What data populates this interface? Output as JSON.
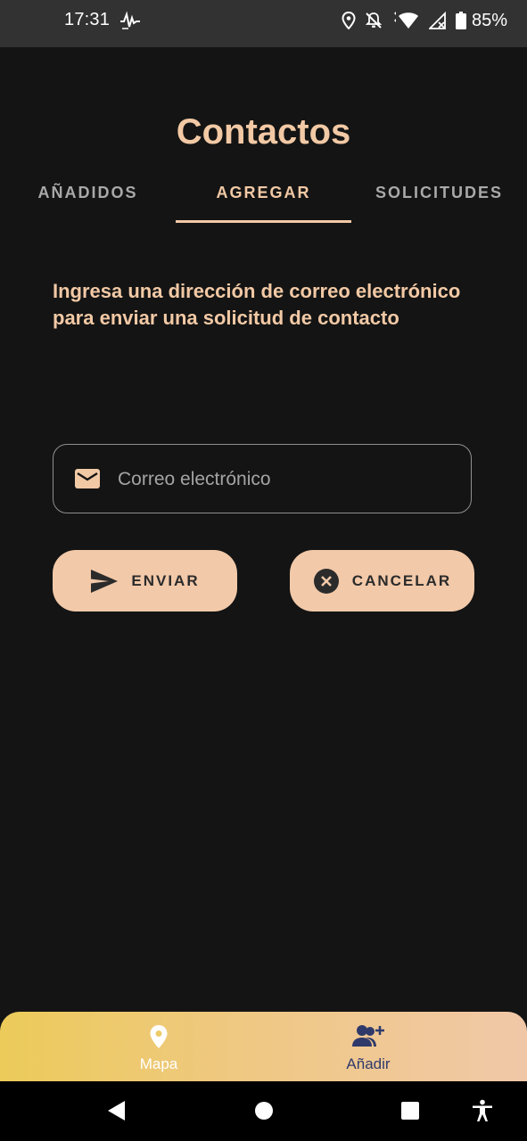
{
  "status_bar": {
    "time": "17:31",
    "battery": "85%"
  },
  "screen_title": "Contactos",
  "tabs": [
    {
      "label": "AÑADIDOS",
      "selected": false
    },
    {
      "label": "AGREGAR",
      "selected": true
    },
    {
      "label": "SOLICITUDES",
      "selected": false
    }
  ],
  "instruction": "Ingresa una dirección de correo electrónico para enviar una solicitud de contacto",
  "email_field": {
    "placeholder": "Correo electrónico",
    "value": ""
  },
  "buttons": {
    "send": "ENVIAR",
    "cancel": "CANCELAR"
  },
  "bottom_nav": [
    {
      "label": "Mapa",
      "icon": "map-pin-icon"
    },
    {
      "label": "Añadir",
      "icon": "add-contact-icon"
    }
  ],
  "colors": {
    "accent": "#f2c9a5",
    "background": "#141414",
    "status_bar": "#323232",
    "button_bg": "#f2c9a9",
    "nav_gradient_start": "#eccb5a",
    "nav_gradient_end": "#f0c8a8",
    "nav_add_color": "#2f3a6a"
  }
}
